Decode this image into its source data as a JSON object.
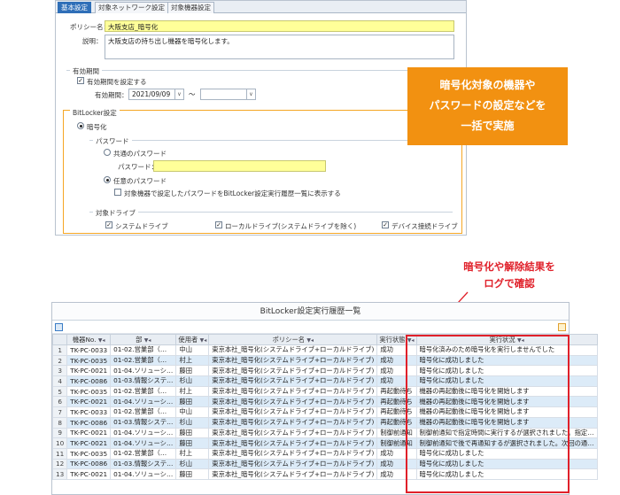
{
  "settings_window": {
    "tabs": [
      "基本設定",
      "対象ネットワーク設定",
      "対象機器設定"
    ],
    "policy_name_label": "ポリシー名：",
    "policy_name_value": "大阪支店_暗号化",
    "description_label": "説明：",
    "description_value": "大阪支店の持ち出し機器を暗号化します。",
    "validity_group": "有効期間",
    "validity_checkbox": "有効期間を設定する",
    "validity_label": "有効期間：",
    "validity_from": "2021/09/09",
    "validity_sep": "～",
    "bitlocker_group": "BitLocker設定",
    "encrypt_radio": "暗号化",
    "password_group": "パスワード",
    "shared_password_radio": "共通のパスワード",
    "password_label": "パスワード：",
    "any_password_radio": "任意のパスワード",
    "show_password_checkbox": "対象機器で設定したパスワードをBitLocker設定実行履歴一覧に表示する",
    "target_drive_group": "対象ドライブ",
    "drive_options": [
      "システムドライブ",
      "ローカルドライブ(システムドライブを除く)",
      "デバイス接続ドライブ"
    ]
  },
  "callout_orange": [
    "暗号化対象の機器や",
    "パスワードの設定などを",
    "一括で実施"
  ],
  "callout_red": [
    "暗号化や解除結果を",
    "ログで確認"
  ],
  "history_window": {
    "title": "BitLocker設定実行履歴一覧",
    "columns": [
      "機器No.",
      "部",
      "使用者",
      "ポリシー名",
      "実行状態",
      "実行状況"
    ],
    "rows": [
      [
        "1",
        "TK-PC-0033",
        "01-02.営業部（…",
        "中山",
        "東京本社_暗号化(システムドライブ+ローカルドライブ)",
        "成功",
        "暗号化済みのため暗号化を実行しませんでした"
      ],
      [
        "2",
        "TK-PC-0035",
        "01-02.営業部（…",
        "村上",
        "東京本社_暗号化(システムドライブ+ローカルドライブ)",
        "成功",
        "暗号化に成功しました"
      ],
      [
        "3",
        "TK-PC-0021",
        "01-04.ソリューシ…",
        "藤田",
        "東京本社_暗号化(システムドライブ+ローカルドライブ)",
        "成功",
        "暗号化に成功しました"
      ],
      [
        "4",
        "TK-PC-0086",
        "01-03.情報システ…",
        "杉山",
        "東京本社_暗号化(システムドライブ+ローカルドライブ)",
        "成功",
        "暗号化に成功しました"
      ],
      [
        "5",
        "TK-PC-0035",
        "01-02.営業部（…",
        "村上",
        "東京本社_暗号化(システムドライブ+ローカルドライブ)",
        "再起動待ち",
        "機器の再起動後に暗号化を開始します"
      ],
      [
        "6",
        "TK-PC-0021",
        "01-04.ソリューシ…",
        "藤田",
        "東京本社_暗号化(システムドライブ+ローカルドライブ)",
        "再起動待ち",
        "機器の再起動後に暗号化を開始します"
      ],
      [
        "7",
        "TK-PC-0033",
        "01-02.営業部（…",
        "中山",
        "東京本社_暗号化(システムドライブ+ローカルドライブ)",
        "再起動待ち",
        "機器の再起動後に暗号化を開始します"
      ],
      [
        "8",
        "TK-PC-0086",
        "01-03.情報システ…",
        "杉山",
        "東京本社_暗号化(システムドライブ+ローカルドライブ)",
        "再起動待ち",
        "機器の再起動後に暗号化を開始します"
      ],
      [
        "9",
        "TK-PC-0021",
        "01-04.ソリューシ…",
        "藤田",
        "東京本社_暗号化(システムドライブ+ローカルドライブ)",
        "制御前通知",
        "制御前通知で指定時間に実行するが選択されました。指定…"
      ],
      [
        "10",
        "TK-PC-0021",
        "01-04.ソリューシ…",
        "藤田",
        "東京本社_暗号化(システムドライブ+ローカルドライブ)",
        "制御前通知",
        "制御前通知で後で再通知するが選択されました。次回の通…"
      ],
      [
        "11",
        "TK-PC-0035",
        "01-02.営業部（…",
        "村上",
        "東京本社_暗号化(システムドライブ+ローカルドライブ)",
        "成功",
        "暗号化に成功しました"
      ],
      [
        "12",
        "TK-PC-0086",
        "01-03.情報システ…",
        "杉山",
        "東京本社_暗号化(システムドライブ+ローカルドライブ)",
        "成功",
        "暗号化に成功しました"
      ],
      [
        "13",
        "TK-PC-0021",
        "01-04.ソリューシ…",
        "藤田",
        "東京本社_暗号化(システムドライブ+ローカルドライブ)",
        "成功",
        "暗号化に成功しました"
      ]
    ]
  },
  "colors": {
    "orange": "#f29111",
    "red": "#e0202a",
    "tab_active": "#2f6fb8",
    "highlight": "#ffff99"
  },
  "icons": [
    "filter-icon",
    "export-icon",
    "toolbar-grid-icon"
  ]
}
